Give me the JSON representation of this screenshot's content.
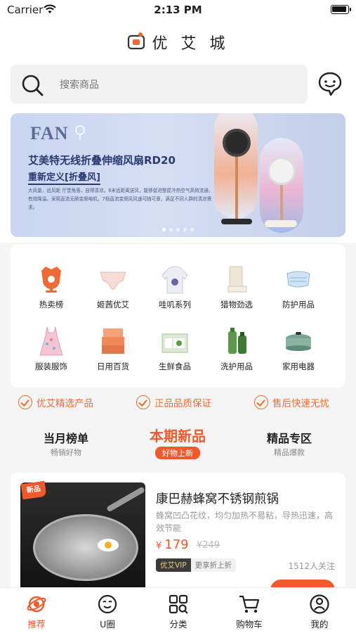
{
  "status_bar": {
    "carrier": "Carrier",
    "time": "2:13 PM"
  },
  "header": {
    "title": "优 艾 城"
  },
  "search": {
    "placeholder": "搜索商品"
  },
  "banner": {
    "logo": "FAN",
    "title": "艾美特无线折叠伸缩风扇RD20",
    "subtitle": "重新定义[折叠风]",
    "description": "大风量，远风距 厅堂角落，自得清凉。6米远距离送风，能够促进整屋冷热空气高效流通，有效降温。采用直流无刷变频电机，7档直流变频风风速可随可意，满足不同人群的清凉需求。"
  },
  "categories": [
    {
      "label": "热卖榜",
      "icon": "hot-list-icon",
      "color": "#f06a35"
    },
    {
      "label": "姬茜优艾",
      "icon": "underwear-icon",
      "color": "#f6dcd6"
    },
    {
      "label": "哇叽系列",
      "icon": "hoodie-icon",
      "color": "#eceef4"
    },
    {
      "label": "猎物劲选",
      "icon": "box-icon",
      "color": "#e9e0d2"
    },
    {
      "label": "防护用品",
      "icon": "mask-icon",
      "color": "#cfe3f5"
    },
    {
      "label": "服装服饰",
      "icon": "dress-icon",
      "color": "#f4c6d3"
    },
    {
      "label": "日用百货",
      "icon": "storage-box-icon",
      "color": "#f08a5a"
    },
    {
      "label": "生鲜食品",
      "icon": "fresh-food-icon",
      "color": "#dfe9d5"
    },
    {
      "label": "洗护用品",
      "icon": "bottles-icon",
      "color": "#5a9a4a"
    },
    {
      "label": "家用电器",
      "icon": "hotpot-icon",
      "color": "#7aa392"
    }
  ],
  "guarantees": [
    "优艾精选产品",
    "正品品质保证",
    "售后快速无忧"
  ],
  "tabs": [
    {
      "title": "当月榜单",
      "subtitle": "畅销好物"
    },
    {
      "title": "本期新品",
      "subtitle": "好物上新"
    },
    {
      "title": "精品专区",
      "subtitle": "精品爆款"
    }
  ],
  "product": {
    "badge": "新品",
    "title": "康巴赫蜂窝不锈钢煎锅",
    "description": "蜂窝凹凸花纹，均匀加热不易粘，导热迅速，高效节能",
    "currency": "¥",
    "price": "179",
    "old_price": "¥249",
    "vip_label": "优艾VIP",
    "vip_note": "更享折上折",
    "followers": "1512人关注"
  },
  "tabbar": [
    {
      "label": "推荐",
      "icon": "planet-icon"
    },
    {
      "label": "U圈",
      "icon": "smile-icon"
    },
    {
      "label": "分类",
      "icon": "category-grid-icon"
    },
    {
      "label": "购物车",
      "icon": "cart-icon"
    },
    {
      "label": "我的",
      "icon": "user-icon"
    }
  ],
  "colors": {
    "accent": "#f05a2a",
    "guarantee": "#f06a35"
  }
}
